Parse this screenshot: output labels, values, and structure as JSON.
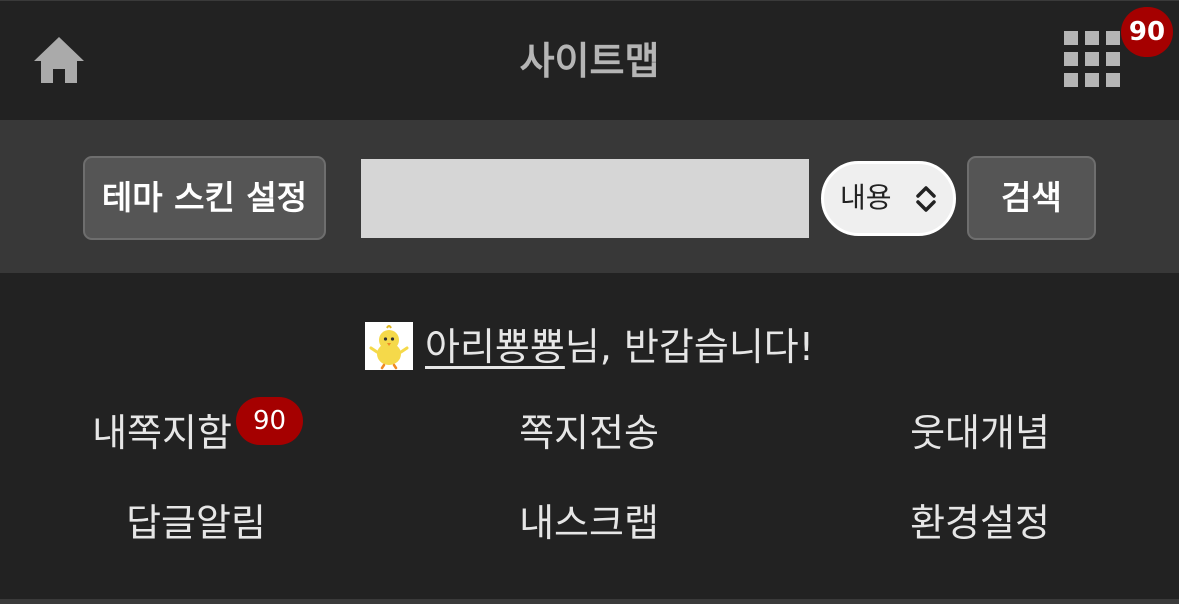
{
  "header": {
    "title": "사이트맵",
    "home_icon": "home-icon",
    "grid_icon": "grid-menu-icon",
    "grid_badge": "90"
  },
  "searchbar": {
    "theme_button_label": "테마 스킨 설정",
    "search_input_value": "",
    "search_scope": "내용",
    "search_button_label": "검색"
  },
  "welcome": {
    "nickname": "아리뿅뿅",
    "suffix": "님, 반갑습니다!"
  },
  "menu": {
    "items": [
      {
        "label": "내쪽지함",
        "badge": "90"
      },
      {
        "label": "쪽지전송"
      },
      {
        "label": "웃대개념"
      },
      {
        "label": "답글알림"
      },
      {
        "label": "내스크랩"
      },
      {
        "label": "환경설정"
      }
    ]
  },
  "colors": {
    "background": "#222222",
    "searchbar_bg": "#383838",
    "badge": "#a50000"
  }
}
